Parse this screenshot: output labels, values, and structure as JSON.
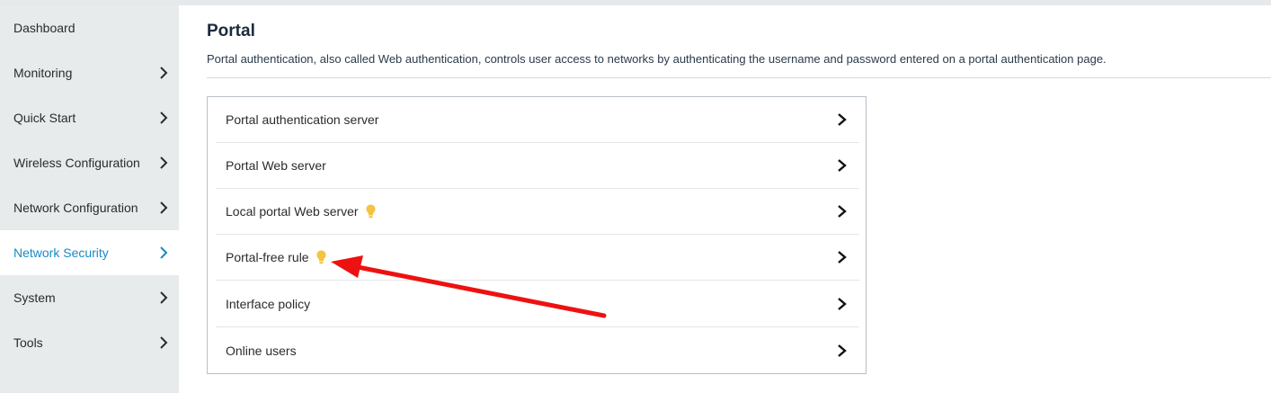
{
  "sidebar": {
    "items": [
      {
        "label": "Dashboard",
        "chevron": false,
        "active": false
      },
      {
        "label": "Monitoring",
        "chevron": true,
        "active": false
      },
      {
        "label": "Quick Start",
        "chevron": true,
        "active": false
      },
      {
        "label": "Wireless Configuration",
        "chevron": true,
        "active": false
      },
      {
        "label": "Network Configuration",
        "chevron": true,
        "active": false
      },
      {
        "label": "Network Security",
        "chevron": true,
        "active": true
      },
      {
        "label": "System",
        "chevron": true,
        "active": false
      },
      {
        "label": "Tools",
        "chevron": true,
        "active": false
      }
    ]
  },
  "main": {
    "title": "Portal",
    "description": "Portal authentication, also called Web authentication, controls user access to networks by authenticating the username and password entered on a portal authentication page.",
    "rows": [
      {
        "label": "Portal authentication server",
        "bulb": false
      },
      {
        "label": "Portal Web server",
        "bulb": false
      },
      {
        "label": "Local portal Web server",
        "bulb": true
      },
      {
        "label": "Portal-free rule",
        "bulb": true
      },
      {
        "label": "Interface policy",
        "bulb": false
      },
      {
        "label": "Online users",
        "bulb": false
      }
    ]
  },
  "icons": {
    "row_chevron": "chevron-right-icon",
    "bulb": "lightbulb-icon",
    "annotation": "red-arrow-annotation"
  },
  "colors": {
    "accent": "#1a8ac6",
    "bulb": "#f5c242",
    "annotation": "#ee1111",
    "sidebar_bg": "#e7ebec"
  }
}
